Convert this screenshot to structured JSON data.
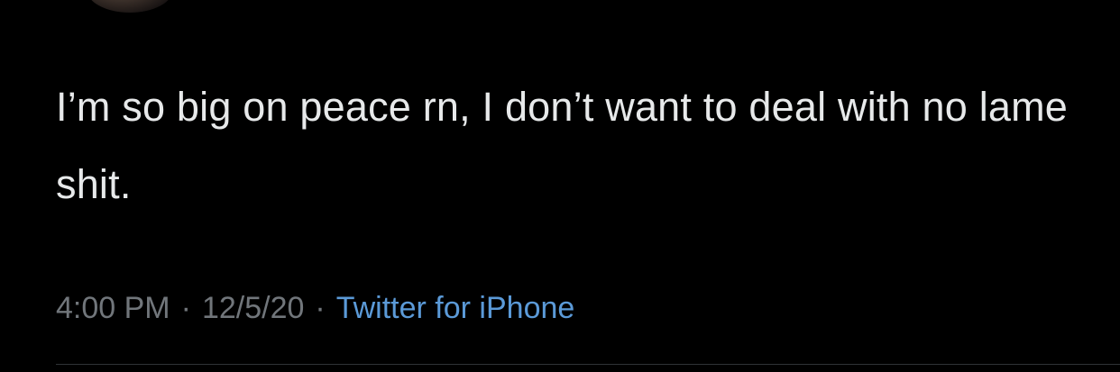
{
  "tweet": {
    "text": "I’m so big on peace rn, I don’t want to deal with no lame shit.",
    "time": "4:00 PM",
    "separator": "·",
    "date": "12/5/20",
    "source": "Twitter for iPhone"
  },
  "colors": {
    "background": "#000000",
    "text": "#e7e9ea",
    "meta": "#71767b",
    "source_link": "#5b9ad8",
    "divider": "#2f3336"
  }
}
